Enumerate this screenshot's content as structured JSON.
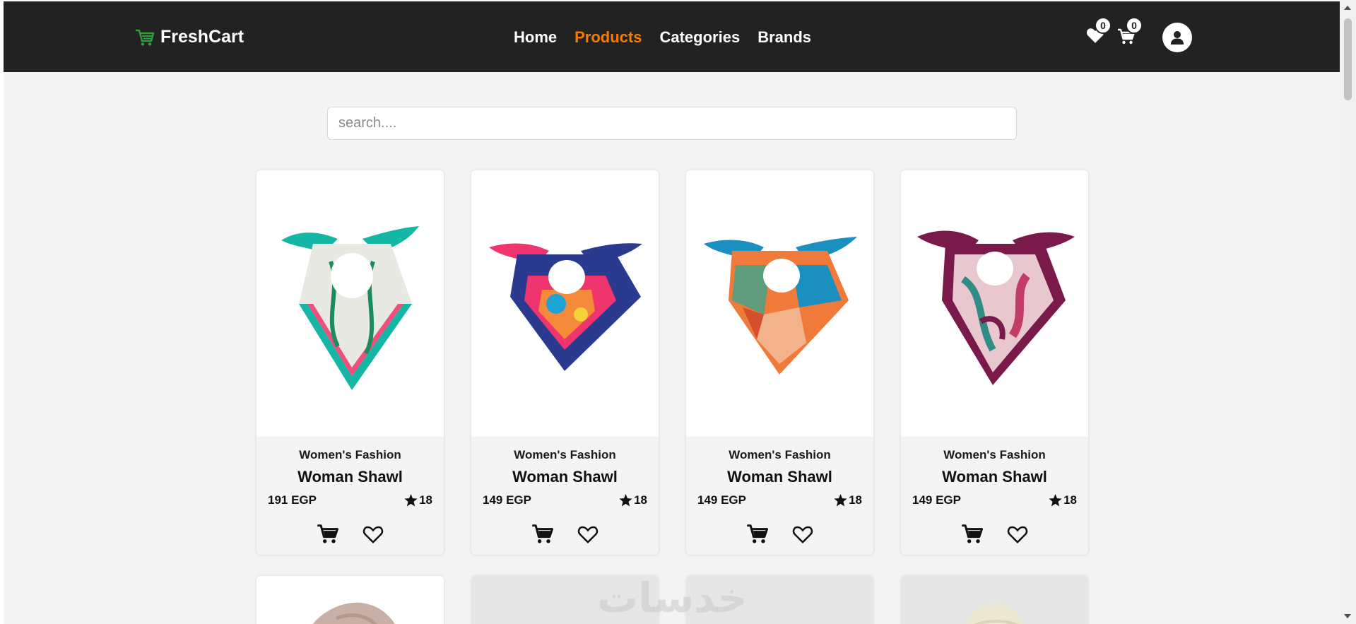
{
  "navbar": {
    "brand": "FreshCart",
    "links": [
      {
        "label": "Home",
        "active": false
      },
      {
        "label": "Products",
        "active": true
      },
      {
        "label": "Categories",
        "active": false
      },
      {
        "label": "Brands",
        "active": false
      }
    ],
    "wishlist_count": "0",
    "cart_count": "0",
    "accent_color": "#f57c00",
    "brand_color": "#2e9d3a"
  },
  "search": {
    "placeholder": "search...."
  },
  "products": [
    {
      "category": "Women's Fashion",
      "title": "Woman Shawl",
      "price": "191 EGP",
      "rating": "18",
      "palette": [
        "#16b6a6",
        "#f04e7c",
        "#1c8c5c",
        "#e9e9e4"
      ]
    },
    {
      "category": "Women's Fashion",
      "title": "Woman Shawl",
      "price": "149 EGP",
      "rating": "18",
      "palette": [
        "#2a3b8f",
        "#f0346e",
        "#f58a3a",
        "#1ea3d6"
      ]
    },
    {
      "category": "Women's Fashion",
      "title": "Woman Shawl",
      "price": "149 EGP",
      "rating": "18",
      "palette": [
        "#f07a3a",
        "#1b8fbf",
        "#5e9c7c",
        "#f2b28a"
      ]
    },
    {
      "category": "Women's Fashion",
      "title": "Woman Shawl",
      "price": "149 EGP",
      "rating": "18",
      "palette": [
        "#7a1a4a",
        "#e8c7cf",
        "#2f8c86",
        "#c23c6a"
      ]
    }
  ],
  "partial_products": [
    {
      "color": "#c8b0a6"
    },
    {
      "color": "#7a1a1e"
    },
    {
      "color": "#c89a72"
    },
    {
      "color": "#eee7d2"
    }
  ],
  "watermark": "خدسات",
  "icons": {
    "cart": "cart-icon",
    "heart": "heart-icon",
    "star": "star-icon",
    "user": "user-icon"
  }
}
